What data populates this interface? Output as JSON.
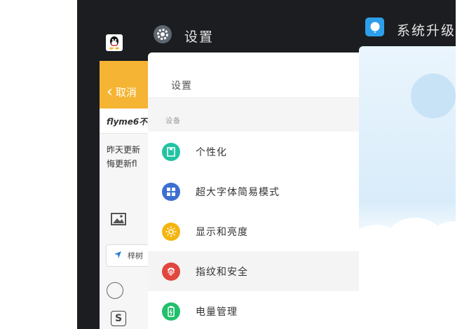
{
  "qq_note": {
    "cancel_label": "取消",
    "note_title": "flyme6不",
    "body_lines": [
      "昨天更新",
      "悔更新fl"
    ],
    "location_text": "梓树"
  },
  "settings_card": {
    "app_title": "设置",
    "page_title": "设置",
    "section_label": "设备",
    "items": [
      {
        "label": "个性化",
        "icon": "personalize-icon",
        "color": "#21c3a3"
      },
      {
        "label": "超大字体简易模式",
        "icon": "large-font-icon",
        "color": "#3c6fd1"
      },
      {
        "label": "显示和亮度",
        "icon": "brightness-icon",
        "color": "#f5b50f"
      },
      {
        "label": "指纹和安全",
        "icon": "fingerprint-icon",
        "color": "#e0473f"
      },
      {
        "label": "电量管理",
        "icon": "battery-icon",
        "color": "#21c06b"
      }
    ]
  },
  "update_card": {
    "app_title": "系统升级"
  },
  "colors": {
    "backdrop": "#1b1d20",
    "qq_header": "#f5b433",
    "update_accent": "#2d9fea"
  }
}
